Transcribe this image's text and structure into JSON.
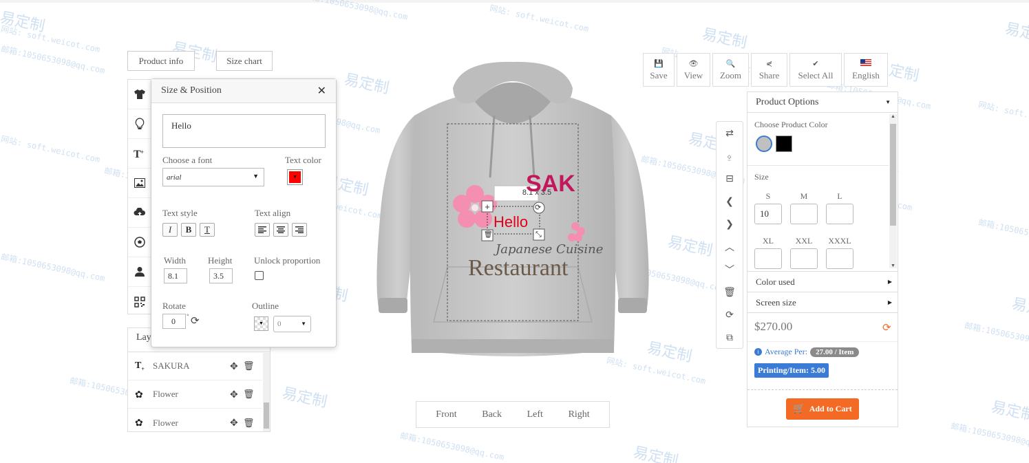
{
  "left_buttons": {
    "product_info": "Product info",
    "size_chart": "Size chart"
  },
  "left_toolbar": [
    "tshirt-icon",
    "lightbulb-icon",
    "text-add-icon",
    "image-icon",
    "cloud-upload-icon",
    "soccer-ball-icon",
    "user-icon",
    "qrcode-icon"
  ],
  "panel": {
    "title": "Size & Position",
    "text_value": "Hello",
    "font_label": "Choose a font",
    "font_value": "arial",
    "text_color_label": "Text color",
    "text_color": "#ff0000",
    "text_style_label": "Text style",
    "text_align_label": "Text align",
    "width_label": "Width",
    "width_value": "8.1",
    "height_label": "Height",
    "height_value": "3.5",
    "unlock_label": "Unlock proportion",
    "rotate_label": "Rotate",
    "rotate_value": "0",
    "rotate_unit": "°",
    "outline_label": "Outline",
    "outline_value": "0"
  },
  "layers": {
    "title": "Lay",
    "items": [
      {
        "name": "SAKURA",
        "icon": "text-icon"
      },
      {
        "name": "Flower",
        "icon": "flower-icon"
      },
      {
        "name": "Flower",
        "icon": "flower-icon"
      }
    ]
  },
  "design": {
    "dimension_label": "8.1 x 3.5",
    "hello_text": "Hello",
    "sakura_text": "SAK",
    "japanese_text": "Japanese Cuisine",
    "restaurant_text": "Restaurant"
  },
  "views": [
    "Front",
    "Back",
    "Left",
    "Right"
  ],
  "toolbar": [
    {
      "label": "Save",
      "icon": "save-icon"
    },
    {
      "label": "View",
      "icon": "eye-icon"
    },
    {
      "label": "Zoom",
      "icon": "search-icon"
    },
    {
      "label": "Share",
      "icon": "share-icon"
    },
    {
      "label": "Select All",
      "icon": "check-icon"
    },
    {
      "label": "English",
      "icon": "us-flag-icon"
    }
  ],
  "options": {
    "title": "Product Options",
    "color_label": "Choose Product Color",
    "colors": [
      "#c0c0c0",
      "#000000"
    ],
    "size_label": "Size",
    "sizes": [
      {
        "label": "S",
        "value": "10"
      },
      {
        "label": "M",
        "value": ""
      },
      {
        "label": "L",
        "value": ""
      },
      {
        "label": "XL",
        "value": ""
      },
      {
        "label": "XXL",
        "value": ""
      },
      {
        "label": "XXXL",
        "value": ""
      }
    ],
    "color_used": "Color used",
    "screen_size": "Screen size",
    "price": "$270.00",
    "average_label": "Average Per:",
    "average_value": "27.00 / Item",
    "printing_label": "Printing/Item: 5.00",
    "add_to_cart": "Add to Cart"
  },
  "watermark": {
    "site": "网站: soft.weicot.com",
    "mail": "邮箱:1050653098@qq.com",
    "brand": "易定制"
  }
}
